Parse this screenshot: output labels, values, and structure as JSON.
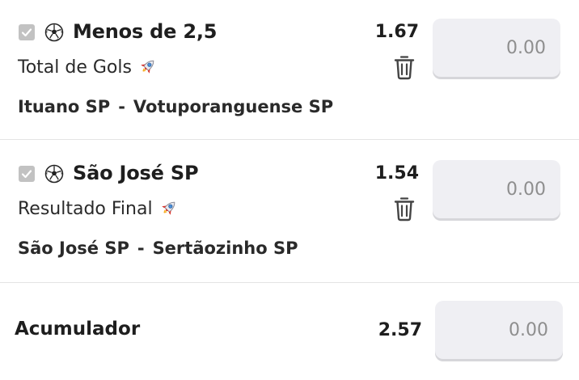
{
  "bets": [
    {
      "selection": "Menos de 2,5",
      "market": "Total de Gols",
      "home_team": "Ituano SP",
      "separator": "-",
      "away_team": "Votuporanguense SP",
      "odds": "1.67",
      "stake_placeholder": "0.00",
      "checked": true
    },
    {
      "selection": "São José SP",
      "market": "Resultado Final",
      "home_team": "São José SP",
      "separator": "-",
      "away_team": "Sertãozinho SP",
      "odds": "1.54",
      "stake_placeholder": "0.00",
      "checked": true
    }
  ],
  "accumulator": {
    "label": "Acumulador",
    "odds": "2.57",
    "stake_placeholder": "0.00"
  },
  "icons": {
    "sport": "soccer-ball-icon",
    "boost": "rocket-icon",
    "remove": "trash-icon",
    "select": "checkbox-check-icon"
  },
  "colors": {
    "text": "#1e1e1e",
    "checkbox": "#c2c2c2",
    "input_bg": "#efeff3",
    "divider": "#e4e4e4",
    "placeholder": "#8e8e8e"
  }
}
